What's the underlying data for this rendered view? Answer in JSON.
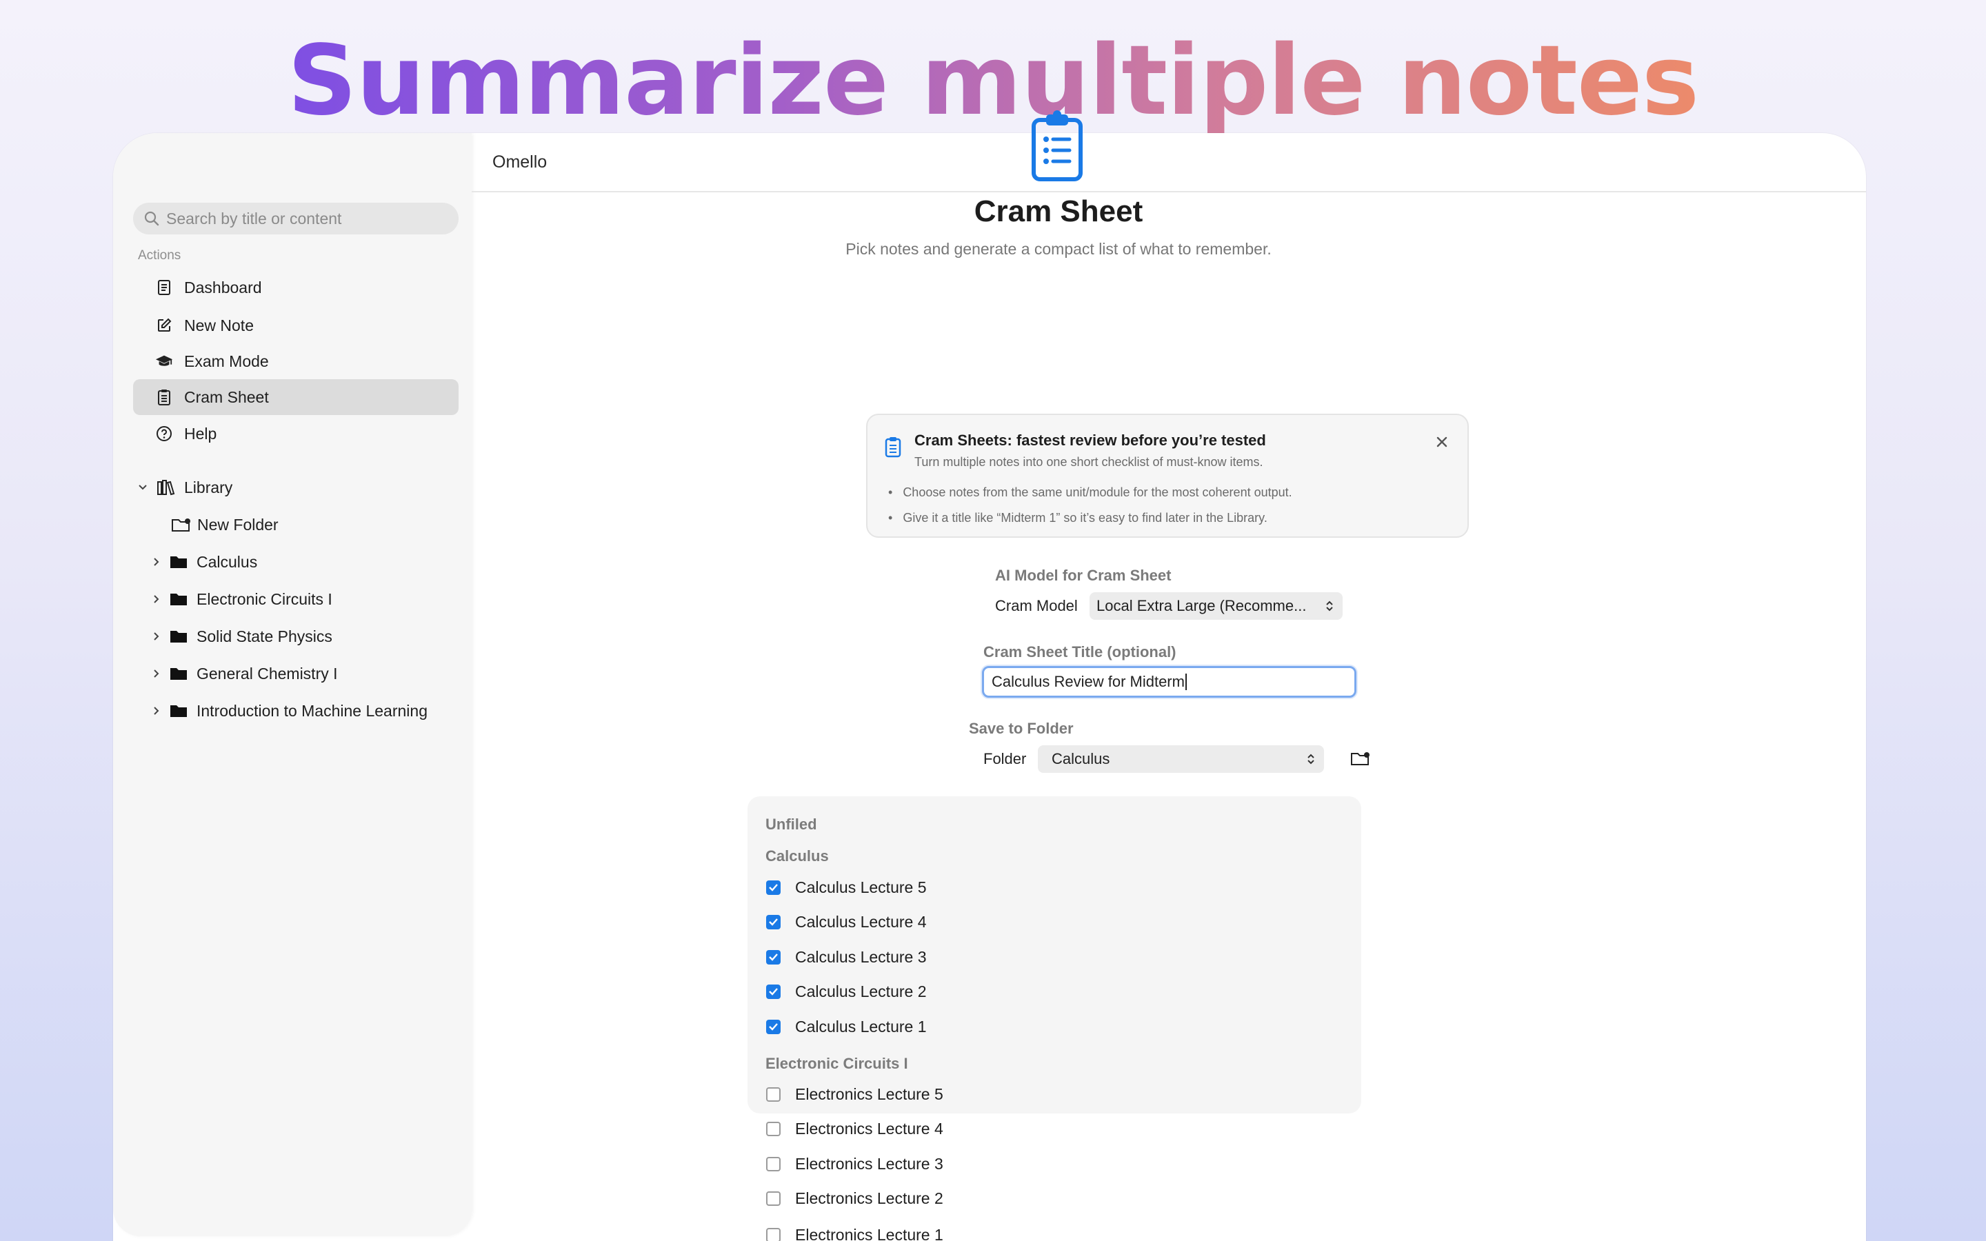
{
  "headline": "Summarize multiple notes",
  "app": {
    "title": "Omello"
  },
  "sidebar": {
    "search_placeholder": "Search by title or content",
    "actions_label": "Actions",
    "actions": [
      {
        "label": "Dashboard",
        "icon": "dashboard-icon"
      },
      {
        "label": "New Note",
        "icon": "compose-icon"
      },
      {
        "label": "Exam Mode",
        "icon": "graduation-cap-icon"
      },
      {
        "label": "Cram Sheet",
        "icon": "clipboard-icon",
        "active": true
      },
      {
        "label": "Help",
        "icon": "question-circle-icon"
      }
    ],
    "library": {
      "label": "Library",
      "new_folder": "New Folder",
      "folders": [
        "Calculus",
        "Electronic Circuits I",
        "Solid State Physics",
        "General Chemistry I",
        "Introduction to Machine Learning"
      ]
    }
  },
  "main": {
    "title": "Cram Sheet",
    "subtitle": "Pick notes and generate a compact list of what to remember.",
    "info": {
      "title": "Cram Sheets: fastest review before you’re tested",
      "subtitle": "Turn multiple notes into one short checklist of must-know items.",
      "bullets": [
        "Choose notes from the same unit/module for the most coherent output.",
        "Give it a title like “Midterm 1” so it’s easy to find later in the Library."
      ]
    },
    "model": {
      "section": "AI Model for Cram Sheet",
      "label": "Cram Model",
      "value": "Local Extra Large (Recomme..."
    },
    "sheet_title": {
      "section": "Cram Sheet Title (optional)",
      "value": "Calculus Review for Midterm"
    },
    "save": {
      "section": "Save to Folder",
      "label": "Folder",
      "value": "Calculus"
    },
    "notes": {
      "unfiled_label": "Unfiled",
      "groups": [
        {
          "name": "Calculus",
          "items": [
            {
              "label": "Calculus Lecture 5",
              "checked": true
            },
            {
              "label": "Calculus Lecture 4",
              "checked": true
            },
            {
              "label": "Calculus Lecture 3",
              "checked": true
            },
            {
              "label": "Calculus Lecture 2",
              "checked": true
            },
            {
              "label": "Calculus Lecture 1",
              "checked": true
            }
          ]
        },
        {
          "name": "Electronic Circuits I",
          "items": [
            {
              "label": "Electronics Lecture 5",
              "checked": false
            },
            {
              "label": "Electronics Lecture 4",
              "checked": false
            },
            {
              "label": "Electronics Lecture 3",
              "checked": false
            },
            {
              "label": "Electronics Lecture 2",
              "checked": false
            },
            {
              "label": "Electronics Lecture 1",
              "checked": false
            }
          ]
        }
      ]
    }
  },
  "colors": {
    "accent": "#1a7ae6",
    "focus_ring": "#7aa9ef",
    "headline_start": "#7f4fe3",
    "headline_end": "#ec8a6b"
  }
}
